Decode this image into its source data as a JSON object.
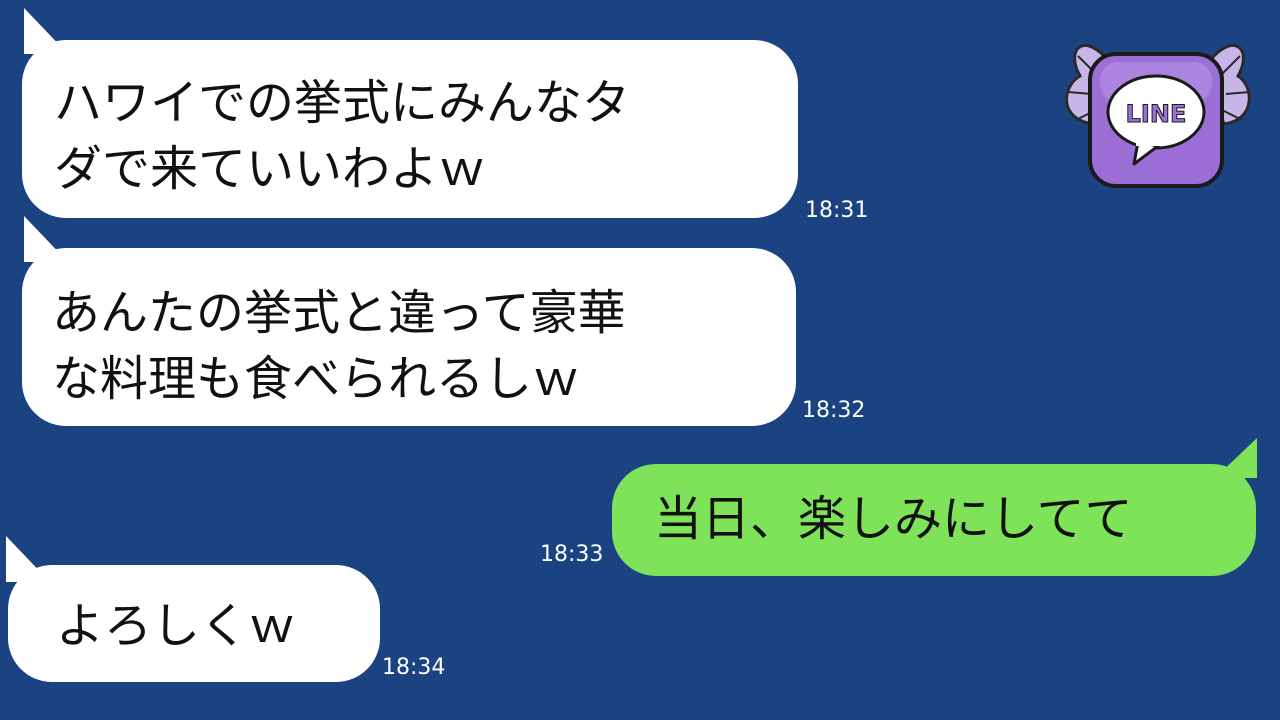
{
  "messages": [
    {
      "direction": "incoming",
      "lines": [
        "ハワイでの挙式にみんなタ",
        "ダで来ていいわよｗ"
      ],
      "time": "18:31"
    },
    {
      "direction": "incoming",
      "lines": [
        "あんたの挙式と違って豪華",
        "な料理も食べられるしｗ"
      ],
      "time": "18:32"
    },
    {
      "direction": "outgoing",
      "lines": [
        "当日、楽しみにしてて"
      ],
      "time": "18:33"
    },
    {
      "direction": "incoming",
      "lines": [
        "よろしくｗ"
      ],
      "time": "18:34"
    }
  ],
  "logo": {
    "text": "LINE",
    "icon": "line-app-logo-icon"
  },
  "colors": {
    "background": "#1b4382",
    "incoming_bubble": "#ffffff",
    "outgoing_bubble": "#7fe35a",
    "timestamp": "#ffffff",
    "logo_purple": "#9b6fd6"
  }
}
